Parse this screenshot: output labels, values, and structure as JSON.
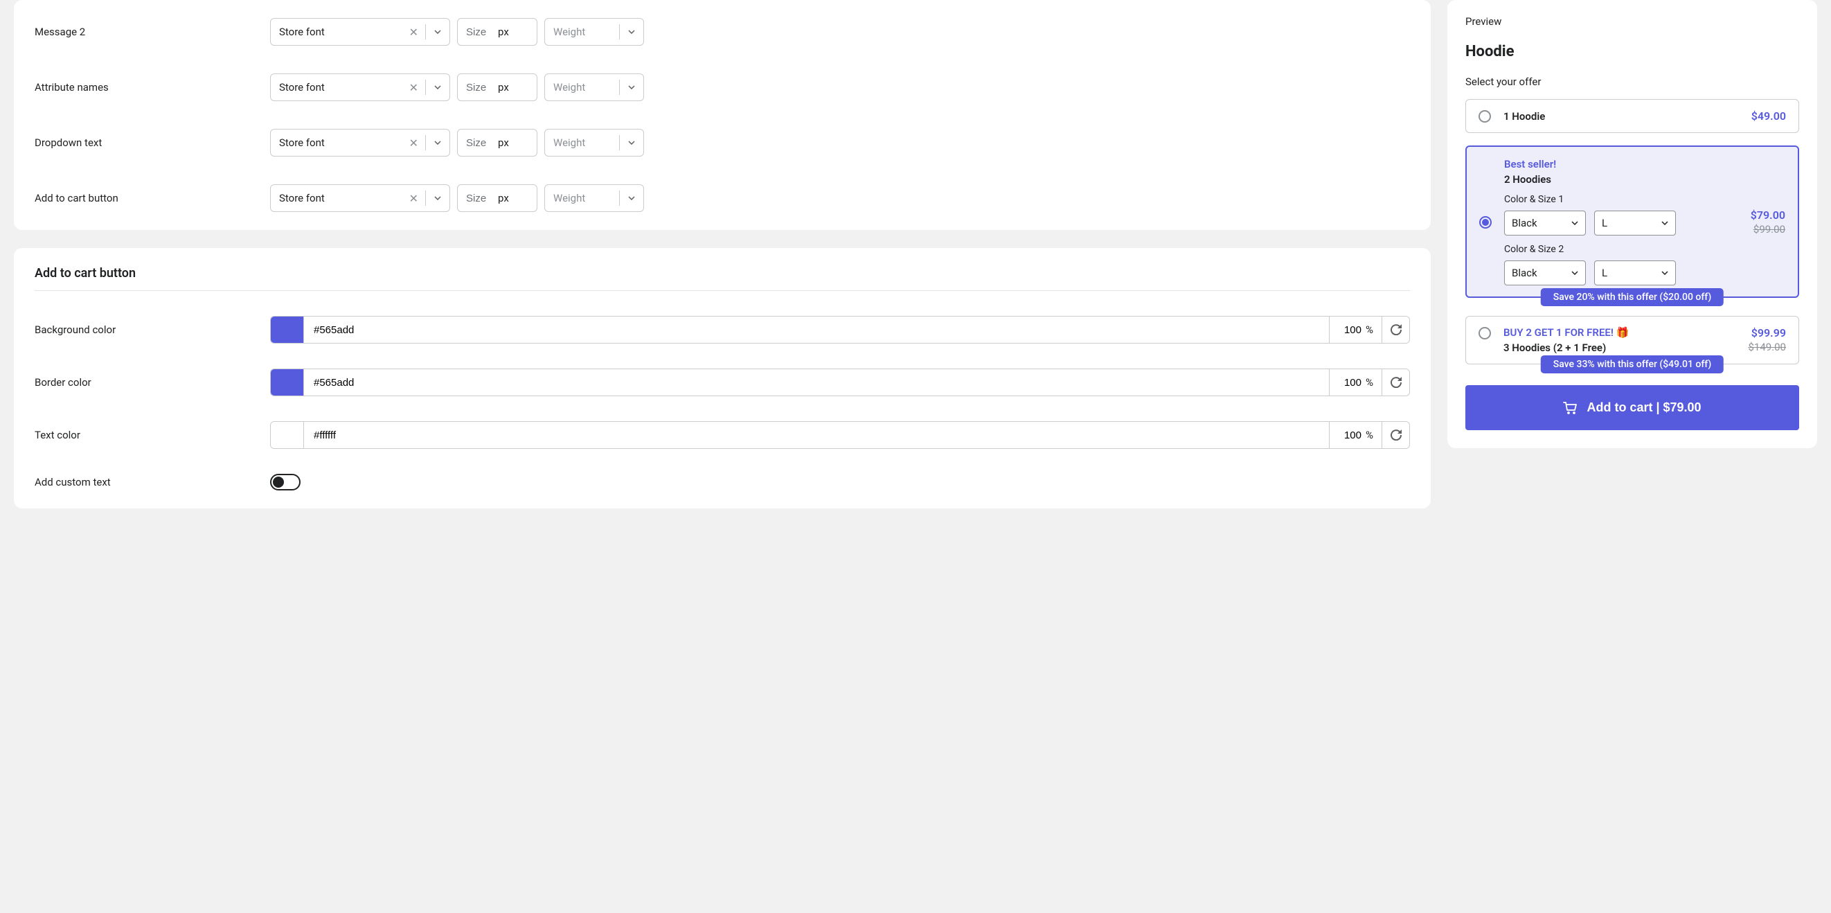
{
  "typography": {
    "rows": [
      {
        "label": "Message 2",
        "font": "Store font",
        "size_ph": "Size",
        "unit": "px",
        "weight_ph": "Weight"
      },
      {
        "label": "Attribute names",
        "font": "Store font",
        "size_ph": "Size",
        "unit": "px",
        "weight_ph": "Weight"
      },
      {
        "label": "Dropdown text",
        "font": "Store font",
        "size_ph": "Size",
        "unit": "px",
        "weight_ph": "Weight"
      },
      {
        "label": "Add to cart button",
        "font": "Store font",
        "size_ph": "Size",
        "unit": "px",
        "weight_ph": "Weight"
      }
    ]
  },
  "cart_section": {
    "title": "Add to cart button",
    "bg_label": "Background color",
    "bg_hex": "#565add",
    "bg_opacity": "100",
    "pct": "%",
    "border_label": "Border color",
    "border_hex": "#565add",
    "border_opacity": "100",
    "text_label": "Text color",
    "text_hex": "#ffffff",
    "text_opacity": "100",
    "custom_label": "Add custom text"
  },
  "preview": {
    "title": "Preview",
    "product": "Hoodie",
    "select_label": "Select your offer",
    "offer1": {
      "name": "1 Hoodie",
      "price": "$49.00"
    },
    "offer2": {
      "badge": "Best seller!",
      "name": "2 Hoodies",
      "price": "$79.00",
      "old_price": "$99.00",
      "variant1_label": "Color & Size 1",
      "variant2_label": "Color & Size 2",
      "color": "Black",
      "size": "L",
      "save": "Save 20% with this offer ($20.00 off)"
    },
    "offer3": {
      "badge": "BUY 2 GET 1 FOR FREE! 🎁",
      "name": "3 Hoodies (2 + 1 Free)",
      "price": "$99.99",
      "old_price": "$149.00",
      "save": "Save 33% with this offer ($49.01 off)"
    },
    "add_to_cart": "Add to cart | $79.00"
  }
}
